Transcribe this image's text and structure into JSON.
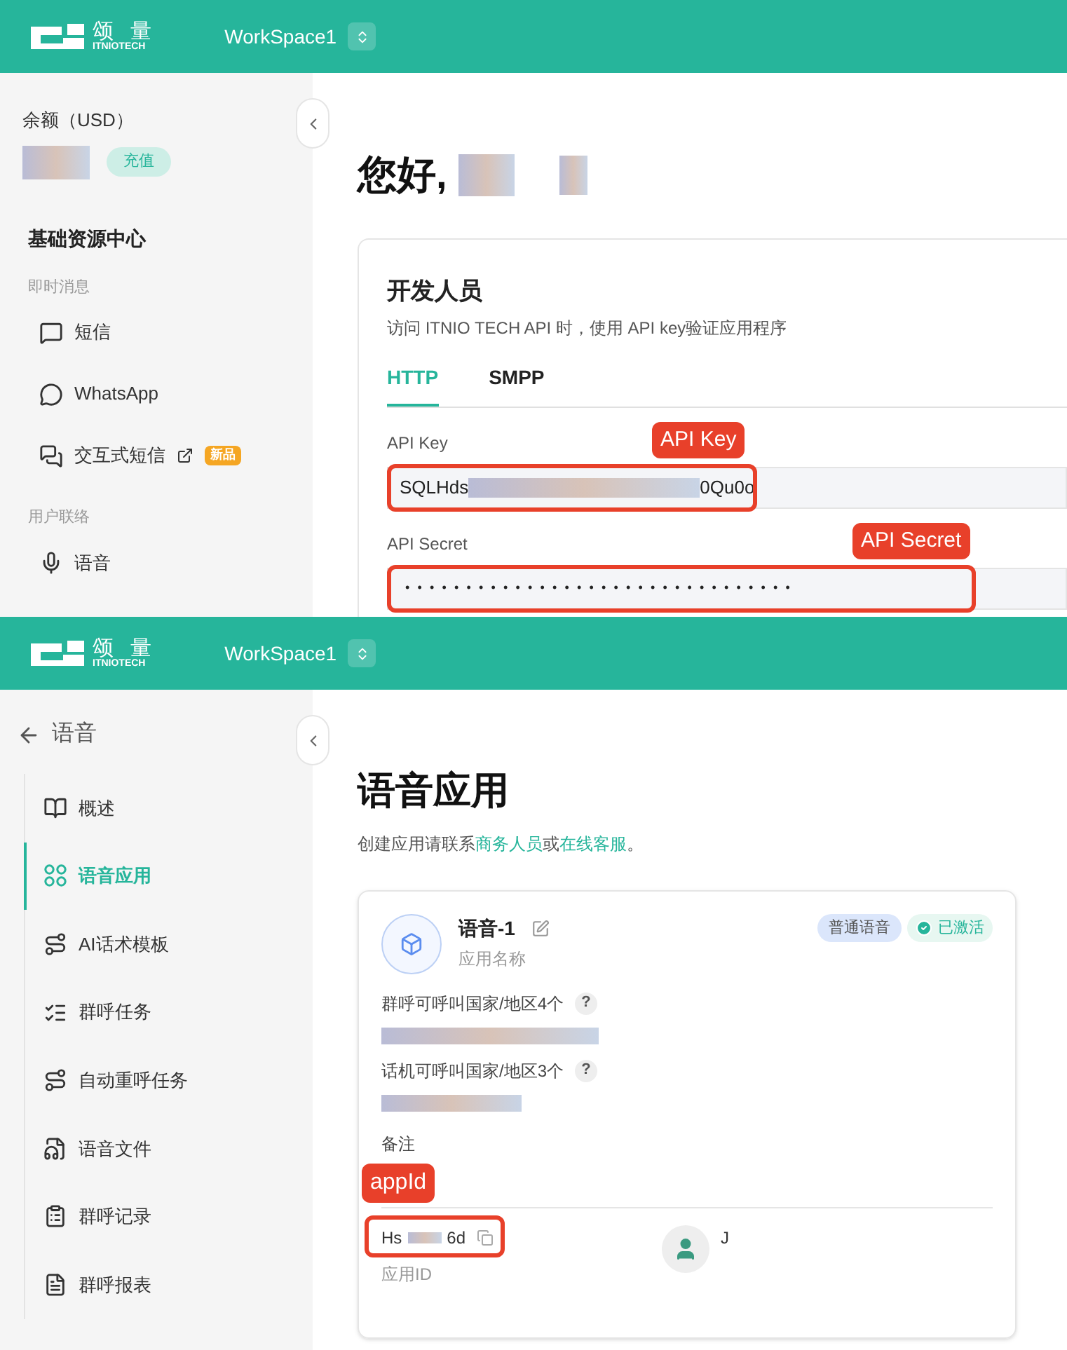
{
  "top": {
    "header": {
      "logo_cn": "颂 量",
      "logo_en": "ITNIOTECH",
      "workspace": "WorkSpace1"
    },
    "sidebar": {
      "balance_label": "余额（USD）",
      "recharge": "充值",
      "section": "基础资源中心",
      "groups": [
        {
          "label": "即时消息",
          "items": [
            {
              "label": "短信",
              "external": false
            },
            {
              "label": "WhatsApp",
              "external": false
            },
            {
              "label": "交互式短信",
              "external": true,
              "badge": "新品"
            }
          ]
        },
        {
          "label": "用户联络",
          "items": [
            {
              "label": "语音",
              "external": false
            }
          ]
        }
      ]
    },
    "greeting": "您好,",
    "developer": {
      "title": "开发人员",
      "subtitle": "访问 ITNIO TECH API 时，使用 API key验证应用程序",
      "tabs": [
        {
          "label": "HTTP",
          "selected": true
        },
        {
          "label": "SMPP",
          "selected": false
        }
      ],
      "key_label": "API Key",
      "key_prefix": "SQLHds",
      "key_suffix": "0Qu0o",
      "key_callout": "API Key",
      "secret_label": "API Secret",
      "secret": "••••••••••••••••••••••••••••••••",
      "secret_callout": "API Secret"
    }
  },
  "bottom": {
    "header": {
      "logo_cn": "颂 量",
      "logo_en": "ITNIOTECH",
      "workspace": "WorkSpace1"
    },
    "sidebar": {
      "back": "语音",
      "items": [
        {
          "label": "概述",
          "selected": false
        },
        {
          "label": "语音应用",
          "selected": true
        },
        {
          "label": "AI话术模板",
          "selected": false
        },
        {
          "label": "群呼任务",
          "selected": false
        },
        {
          "label": "自动重呼任务",
          "selected": false
        },
        {
          "label": "语音文件",
          "selected": false
        },
        {
          "label": "群呼记录",
          "selected": false
        },
        {
          "label": "群呼报表",
          "selected": false
        }
      ]
    },
    "title": "语音应用",
    "intro": [
      {
        "kind": "text",
        "text": "创建应用请联系"
      },
      {
        "kind": "link",
        "text": "商务人员"
      },
      {
        "kind": "text",
        "text": "或"
      },
      {
        "kind": "link",
        "text": "在线客服"
      },
      {
        "kind": "text",
        "text": "。"
      }
    ],
    "card": {
      "name": "语音-1",
      "name_label": "应用名称",
      "type_tag": "普通语音",
      "status": "已激活",
      "group_call": "群呼可呼叫国家/地区4个",
      "agent_call": "话机可呼叫国家/地区3个",
      "help": "?",
      "note": "备注",
      "app_id_prefix": "Hs",
      "app_id_suffix": "6d",
      "app_id_label": "应用ID",
      "app_id_callout": "appId",
      "creator": "J"
    }
  }
}
